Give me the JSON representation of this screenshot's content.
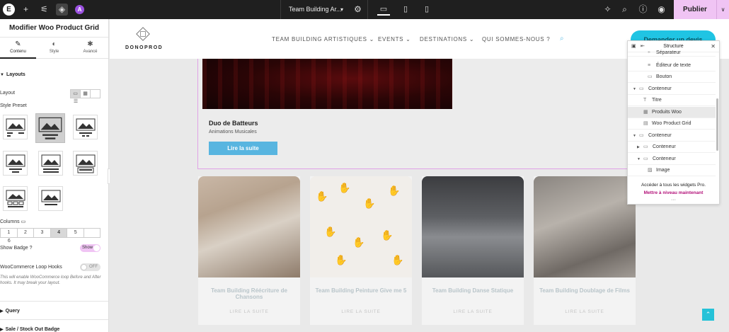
{
  "topbar": {
    "logo": "E",
    "icons": [
      "plus-icon",
      "sliders-icon",
      "layers-icon"
    ],
    "ai_badge": "A",
    "page_title": "Team Building Ar...",
    "publish_label": "Publier",
    "accent": "#f0c4f4"
  },
  "panel": {
    "title": "Modifier Woo Product Grid",
    "tabs": [
      {
        "label": "Contenu"
      },
      {
        "label": "Style"
      },
      {
        "label": "Avancé"
      }
    ],
    "layouts_title": "Layouts",
    "layout_label": "Layout",
    "style_preset_label": "Style Preset",
    "columns_label": "Columns",
    "columns": [
      "1",
      "2",
      "3",
      "4",
      "5",
      "6"
    ],
    "columns_selected": "4",
    "show_badge_label": "Show Badge ?",
    "show_badge_value": "Show",
    "loop_hooks_label": "WooCommerce Loop Hooks",
    "loop_hooks_value": "OFF",
    "loop_hooks_desc": "This will enable WooCommerce loop Before and After hooks. It may break your layout.",
    "query_title": "Query",
    "badge_title": "Sale / Stock Out Badge"
  },
  "site": {
    "brand": "DONOPROD",
    "nav": [
      {
        "label": "TEAM BUILDING ARTISTIQUES"
      },
      {
        "label": "EVENTS"
      },
      {
        "label": "DESTINATIONS"
      },
      {
        "label": "QUI SOMMES-NOUS ?"
      }
    ],
    "cta": "Demander un devis",
    "featured": {
      "title": "Duo de Batteurs",
      "subtitle": "Animations Musicales",
      "button": "Lire la suite"
    },
    "cards": [
      {
        "title": "Team Building Réécriture de Chansons",
        "more": "LIRE LA SUITE"
      },
      {
        "title": "Team Building Peinture Give me 5",
        "more": "LIRE LA SUITE"
      },
      {
        "title": "Team Building Danse Statique",
        "more": "LIRE LA SUITE"
      },
      {
        "title": "Team Building Doublage de Films",
        "more": "LIRE LA SUITE"
      }
    ]
  },
  "structure": {
    "title": "Structure",
    "items": [
      {
        "label": "Séparateur"
      },
      {
        "label": "Éditeur de texte"
      },
      {
        "label": "Bouton"
      },
      {
        "label": "Conteneur"
      },
      {
        "label": "Titre"
      },
      {
        "label": "Produits Woo"
      },
      {
        "label": "Woo Product Grid"
      },
      {
        "label": "Conteneur"
      },
      {
        "label": "Conteneur"
      },
      {
        "label": "Conteneur"
      },
      {
        "label": "Image"
      }
    ],
    "promo": "Accéder à tous les widgets Pro.",
    "upgrade": "Mettre à niveau maintenant"
  }
}
